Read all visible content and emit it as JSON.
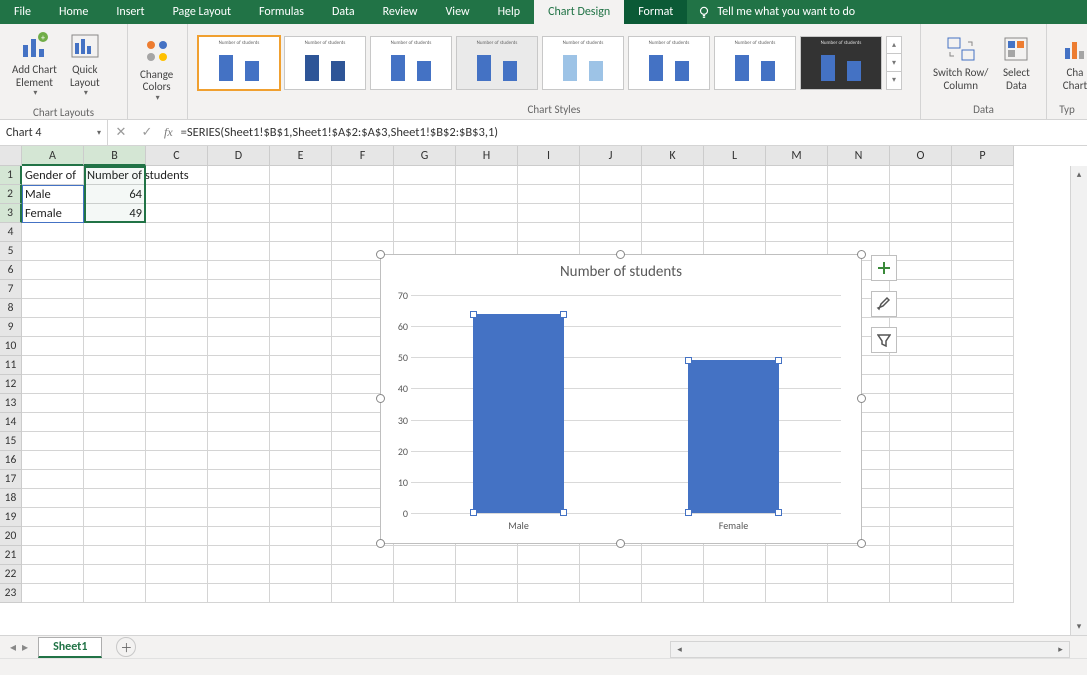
{
  "tabs": {
    "file": "File",
    "home": "Home",
    "insert": "Insert",
    "page_layout": "Page Layout",
    "formulas": "Formulas",
    "data": "Data",
    "review": "Review",
    "view": "View",
    "help": "Help",
    "chart_design": "Chart Design",
    "format": "Format",
    "tellme": "Tell me what you want to do"
  },
  "ribbon": {
    "add_element": "Add Chart\nElement",
    "quick_layout": "Quick\nLayout",
    "change_colors": "Change\nColors",
    "switch": "Switch Row/\nColumn",
    "select_data": "Select\nData",
    "change_type": "Cha\nChart",
    "group_layouts": "Chart Layouts",
    "group_styles": "Chart Styles",
    "group_data": "Data",
    "group_type": "Typ",
    "gallery_title": "Number of students"
  },
  "namebox": "Chart 4",
  "formula": "=SERIES(Sheet1!$B$1,Sheet1!$A$2:$A$3,Sheet1!$B$2:$B$3,1)",
  "columns": [
    "A",
    "B",
    "C",
    "D",
    "E",
    "F",
    "G",
    "H",
    "I",
    "J",
    "K",
    "L",
    "M",
    "N",
    "O",
    "P"
  ],
  "cells": {
    "A1": "Gender of",
    "B1": "Number of students",
    "A2": "Male",
    "B2": "64",
    "A3": "Female",
    "B3": "49"
  },
  "chart_data": {
    "type": "bar",
    "title": "Number of students",
    "categories": [
      "Male",
      "Female"
    ],
    "values": [
      64,
      49
    ],
    "ylim": [
      0,
      70
    ],
    "yticks": [
      0,
      10,
      20,
      30,
      40,
      50,
      60,
      70
    ]
  },
  "sheet": {
    "name": "Sheet1"
  }
}
